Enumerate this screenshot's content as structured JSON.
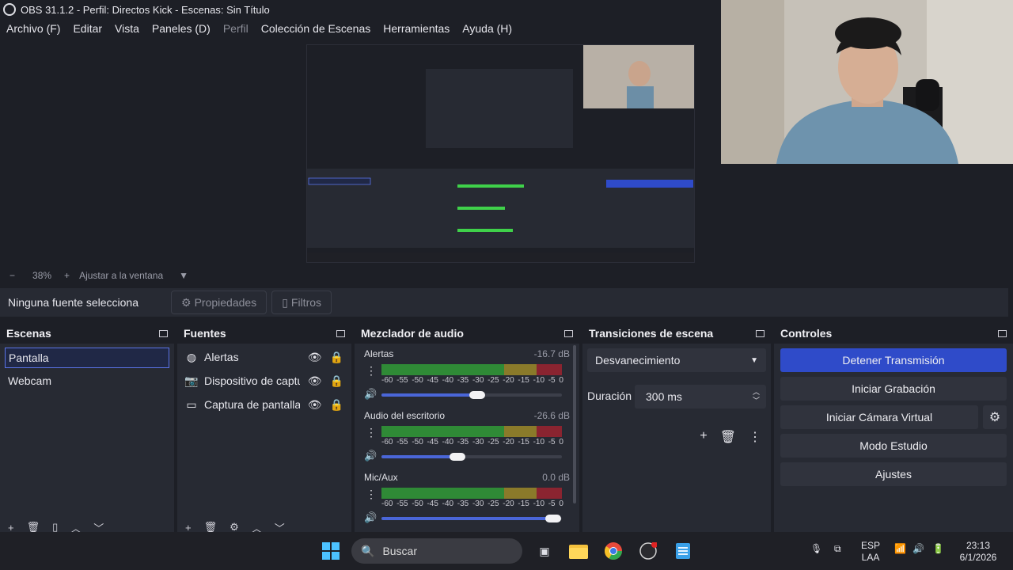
{
  "window": {
    "title": "OBS 31.1.2 - Perfil: Directos Kick - Escenas: Sin Título"
  },
  "menu": [
    "Archivo (F)",
    "Editar",
    "Vista",
    "Paneles (D)",
    "Perfil",
    "Colección de Escenas",
    "Herramientas",
    "Ayuda (H)"
  ],
  "zoom": {
    "minus": "−",
    "level": "38%",
    "plus": "+",
    "fit": "Ajustar a la ventana"
  },
  "source_toolbar": {
    "none_selected": "Ninguna fuente selecciona",
    "properties": "Propiedades",
    "filters": "Filtros"
  },
  "scenes": {
    "title": "Escenas",
    "items": [
      "Pantalla",
      "Webcam"
    ]
  },
  "sources": {
    "title": "Fuentes",
    "items": [
      "Alertas",
      "Dispositivo de captura",
      "Captura de pantalla"
    ]
  },
  "mixer": {
    "title": "Mezclador de audio",
    "ticks": [
      "-60",
      "-55",
      "-50",
      "-45",
      "-40",
      "-35",
      "-30",
      "-25",
      "-20",
      "-15",
      "-10",
      "-5",
      "0"
    ],
    "channels": [
      {
        "name": "Alertas",
        "level": "-16.7 dB",
        "volume": 0.53
      },
      {
        "name": "Audio del escritorio",
        "level": "-26.6 dB",
        "volume": 0.42
      },
      {
        "name": "Mic/Aux",
        "level": "0.0 dB",
        "volume": 0.95
      }
    ]
  },
  "transitions": {
    "title": "Transiciones de escena",
    "selected": "Desvanecimiento",
    "duration_label": "Duración",
    "duration": "300 ms"
  },
  "controls": {
    "title": "Controles",
    "stop_stream": "Detener Transmisión",
    "start_record": "Iniciar Grabación",
    "start_vcam": "Iniciar Cámara Virtual",
    "studio": "Modo Estudio",
    "settings": "Ajustes"
  },
  "taskbar": {
    "search": "Buscar",
    "lang1": "ESP",
    "lang2": "LAA",
    "time": "23:13",
    "date": "6/1/2026"
  },
  "colors": {
    "accent": "#2f4bc9",
    "selected_border": "#5b74e8",
    "meter_green": "#3fd14a",
    "meter_yellow": "#c9b53a",
    "meter_red": "#c03a3a"
  }
}
